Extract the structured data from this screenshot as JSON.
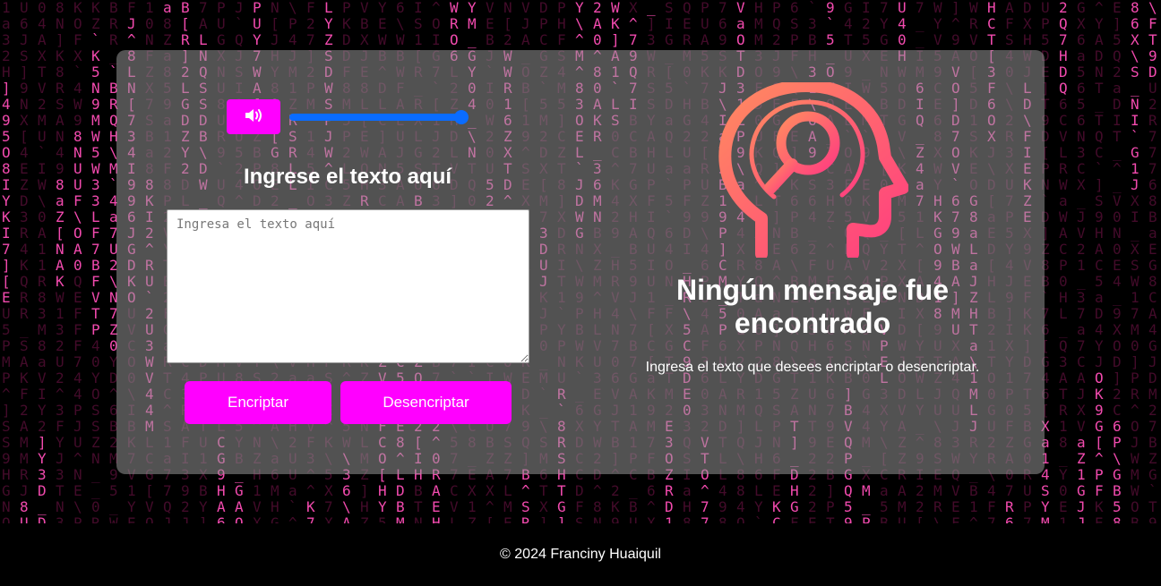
{
  "colors": {
    "accent": "#ff00ff",
    "slider": "#0a6cff",
    "matrix_bright": "#ff4fb8",
    "matrix_dim": "#5a0f38",
    "card": "rgba(150,150,150,0.55)",
    "illustration_gradient": [
      "#ff8a60",
      "#ff3d80"
    ]
  },
  "sound": {
    "icon": "speaker-volume-icon",
    "volume": 1.0
  },
  "input": {
    "title": "Ingrese el texto aquí",
    "placeholder": "Ingresa el texto aquí",
    "value": ""
  },
  "buttons": {
    "encrypt": "Encriptar",
    "decrypt": "Desencriptar"
  },
  "result": {
    "icon": "head-magnifier-icon",
    "title": "Ningún mensaje fue encontrado",
    "subtitle": "Ingresa el texto que desees encriptar o desencriptar."
  },
  "footer": {
    "text": "© 2024 Franciny Huaiquil"
  }
}
